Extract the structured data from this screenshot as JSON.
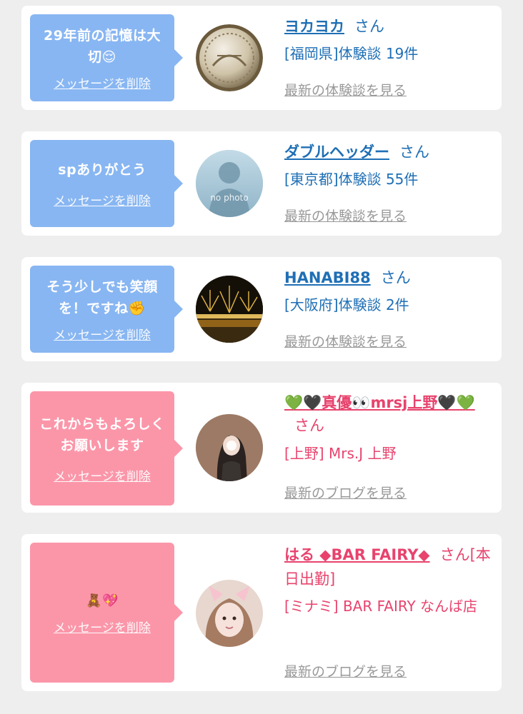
{
  "cards": [
    {
      "message": "29年前の記憶は大切😌",
      "delete_label": "メッセージを削除",
      "name": "ヨカヨカ",
      "san": "さん",
      "detail": "[福岡県]体験談 19件",
      "latest": "最新の体験談を見る",
      "avatar_icon": "coin-avatar",
      "theme": "blue"
    },
    {
      "message": "spありがとう",
      "delete_label": "メッセージを削除",
      "name": "ダブルヘッダー",
      "san": "さん",
      "detail": "[東京都]体験談 55件",
      "latest": "最新の体験談を見る",
      "avatar_icon": "no-photo-avatar",
      "avatar_text": "no photo",
      "theme": "blue"
    },
    {
      "message": "そう少しでも笑顔を！ですね✊",
      "delete_label": "メッセージを削除",
      "name": "HANABI88",
      "san": "さん",
      "detail": "[大阪府]体験談 2件",
      "latest": "最新の体験談を見る",
      "avatar_icon": "fireworks-avatar",
      "theme": "blue"
    },
    {
      "message": "これからもよろしくお願いします",
      "delete_label": "メッセージを削除",
      "name": "💚🖤真優👀mrsj上野🖤💚",
      "san": "さん",
      "detail": "[上野] Mrs.J 上野",
      "latest": "最新のブログを見る",
      "avatar_icon": "woman-photo-avatar",
      "theme": "pink"
    },
    {
      "message": "🧸💖",
      "delete_label": "メッセージを削除",
      "name": "はる ◆BAR FAIRY◆",
      "san": "さん[本日出勤]",
      "detail": "[ミナミ] BAR FAIRY なんば店",
      "latest": "最新のブログを見る",
      "avatar_icon": "cat-ears-photo-avatar",
      "theme": "pink"
    }
  ],
  "colors": {
    "blue_bubble": "#88b6f2",
    "pink_bubble": "#fb96a9",
    "blue_text": "#1f6fb5",
    "pink_text": "#e8436d",
    "muted": "#999999"
  }
}
